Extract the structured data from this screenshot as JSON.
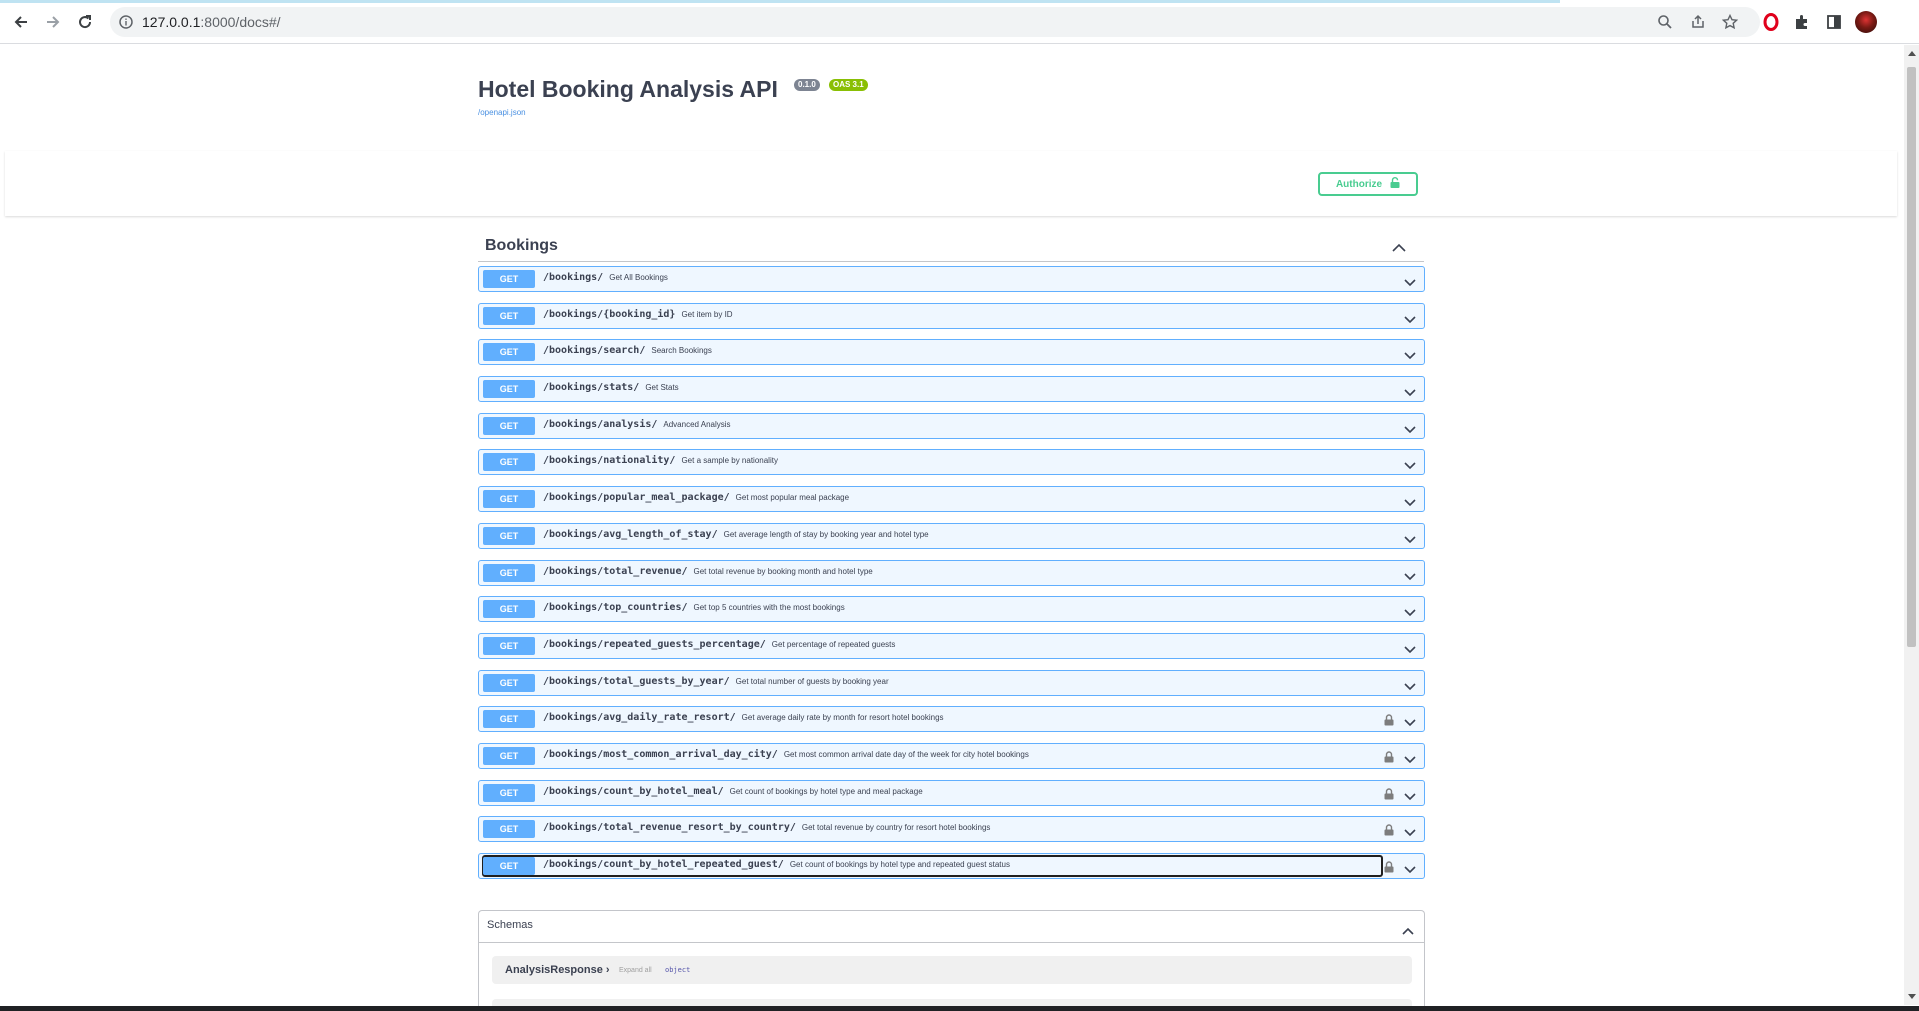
{
  "browser": {
    "url_host": "127.0.0.1",
    "url_rest": ":8000/docs#/",
    "icons": [
      "back-icon",
      "forward-icon",
      "reload-icon",
      "info-icon",
      "zoom-icon",
      "share-icon",
      "star-icon",
      "opera-icon",
      "extensions-icon",
      "sidepanel-icon",
      "profile-avatar"
    ]
  },
  "info": {
    "title": "Hotel Booking Analysis API",
    "version": "0.1.0",
    "oas": "OAS 3.1",
    "spec_link": "/openapi.json"
  },
  "authorize": {
    "label": "Authorize"
  },
  "tag": {
    "name": "Bookings"
  },
  "operations": [
    {
      "method": "GET",
      "path": "/bookings/",
      "summary": "Get All Bookings",
      "locked": false
    },
    {
      "method": "GET",
      "path": "/bookings/{booking_id}",
      "summary": "Get item by ID",
      "locked": false
    },
    {
      "method": "GET",
      "path": "/bookings/search/",
      "summary": "Search Bookings",
      "locked": false
    },
    {
      "method": "GET",
      "path": "/bookings/stats/",
      "summary": "Get Stats",
      "locked": false
    },
    {
      "method": "GET",
      "path": "/bookings/analysis/",
      "summary": "Advanced Analysis",
      "locked": false
    },
    {
      "method": "GET",
      "path": "/bookings/nationality/",
      "summary": "Get a sample by nationality",
      "locked": false
    },
    {
      "method": "GET",
      "path": "/bookings/popular_meal_package/",
      "summary": "Get most popular meal package",
      "locked": false
    },
    {
      "method": "GET",
      "path": "/bookings/avg_length_of_stay/",
      "summary": "Get average length of stay by booking year and hotel type",
      "locked": false
    },
    {
      "method": "GET",
      "path": "/bookings/total_revenue/",
      "summary": "Get total revenue by booking month and hotel type",
      "locked": false
    },
    {
      "method": "GET",
      "path": "/bookings/top_countries/",
      "summary": "Get top 5 countries with the most bookings",
      "locked": false
    },
    {
      "method": "GET",
      "path": "/bookings/repeated_guests_percentage/",
      "summary": "Get percentage of repeated guests",
      "locked": false
    },
    {
      "method": "GET",
      "path": "/bookings/total_guests_by_year/",
      "summary": "Get total number of guests by booking year",
      "locked": false
    },
    {
      "method": "GET",
      "path": "/bookings/avg_daily_rate_resort/",
      "summary": "Get average daily rate by month for resort hotel bookings",
      "locked": true
    },
    {
      "method": "GET",
      "path": "/bookings/most_common_arrival_day_city/",
      "summary": "Get most common arrival date day of the week for city hotel bookings",
      "locked": true
    },
    {
      "method": "GET",
      "path": "/bookings/count_by_hotel_meal/",
      "summary": "Get count of bookings by hotel type and meal package",
      "locked": true
    },
    {
      "method": "GET",
      "path": "/bookings/total_revenue_resort_by_country/",
      "summary": "Get total revenue by country for resort hotel bookings",
      "locked": true
    },
    {
      "method": "GET",
      "path": "/bookings/count_by_hotel_repeated_guest/",
      "summary": "Get count of bookings by hotel type and repeated guest status",
      "locked": true,
      "focused": true
    }
  ],
  "schemas": {
    "title": "Schemas",
    "models": [
      {
        "name": "AnalysisResponse",
        "expand_label": "Expand all",
        "type": "object"
      }
    ]
  },
  "colors": {
    "get": "#61affe",
    "authorize": "#49cc90",
    "version_badge": "#7d8492",
    "oas_badge": "#89bf04"
  }
}
